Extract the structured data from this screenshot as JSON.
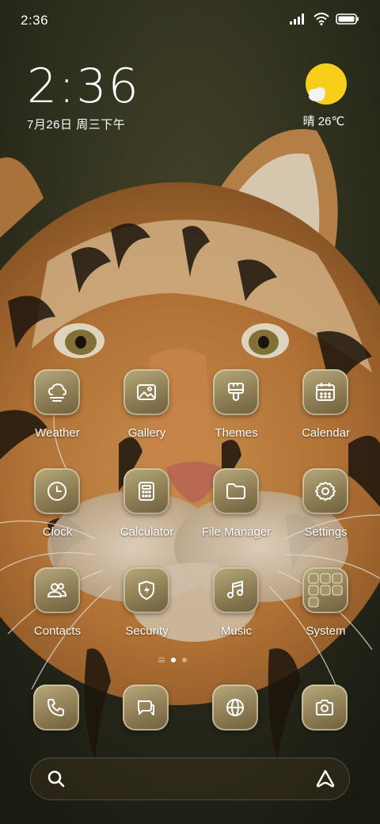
{
  "status_bar": {
    "time": "2:36",
    "signal_icon": "signal-icon",
    "wifi_icon": "wifi-icon",
    "battery_icon": "battery-icon"
  },
  "clock_widget": {
    "time": "2:36",
    "date": "7月26日 周三下午"
  },
  "weather_widget": {
    "text": "晴 26℃",
    "icon": "sunny-weather-icon"
  },
  "apps": [
    {
      "label": "Weather",
      "icon": "weather-icon"
    },
    {
      "label": "Gallery",
      "icon": "gallery-icon"
    },
    {
      "label": "Themes",
      "icon": "themes-icon"
    },
    {
      "label": "Calendar",
      "icon": "calendar-icon"
    },
    {
      "label": "Clock",
      "icon": "clock-icon"
    },
    {
      "label": "Calculator",
      "icon": "calculator-icon"
    },
    {
      "label": "File Manager",
      "icon": "folder-icon"
    },
    {
      "label": "Settings",
      "icon": "gear-icon"
    },
    {
      "label": "Contacts",
      "icon": "contacts-icon"
    },
    {
      "label": "Security",
      "icon": "shield-icon"
    },
    {
      "label": "Music",
      "icon": "music-icon"
    },
    {
      "label": "System",
      "icon": "app-folder-icon"
    }
  ],
  "dock": [
    {
      "icon": "phone-icon"
    },
    {
      "icon": "messages-icon"
    },
    {
      "icon": "browser-icon"
    },
    {
      "icon": "camera-icon"
    }
  ],
  "page_indicator": {
    "pages": 2,
    "current": 1
  },
  "search_bar": {
    "search_icon": "search-icon",
    "assistant_icon": "assistant-icon"
  },
  "colors": {
    "icon_bg": "#8f7e55",
    "sun": "#f7cf1a",
    "text": "#ffffff"
  }
}
